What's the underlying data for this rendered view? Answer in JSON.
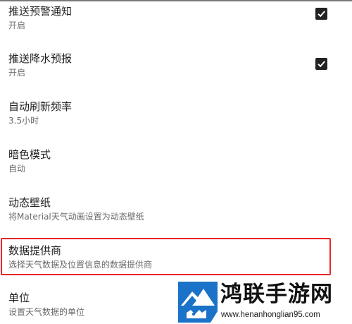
{
  "settings": {
    "items": [
      {
        "title": "推送预警通知",
        "summary": "开启",
        "checked": true
      },
      {
        "title": "推送降水预报",
        "summary": "开启",
        "checked": true
      },
      {
        "title": "自动刷新频率",
        "summary": "3.5小时"
      },
      {
        "title": "暗色模式",
        "summary": "自动"
      },
      {
        "title": "动态壁纸",
        "summary": "将Material天气动画设置为动态壁纸"
      },
      {
        "title": "数据提供商",
        "summary": "选择天气数据及位置信息的数据提供商"
      },
      {
        "title": "单位",
        "summary": "设置天气数据的单位"
      }
    ]
  },
  "highlight": {
    "color": "#e8282a"
  },
  "watermark": {
    "name": "鸿联手游网",
    "url": "www.henanhonglian95.com",
    "logo_icon": "mountain-logo-icon"
  }
}
